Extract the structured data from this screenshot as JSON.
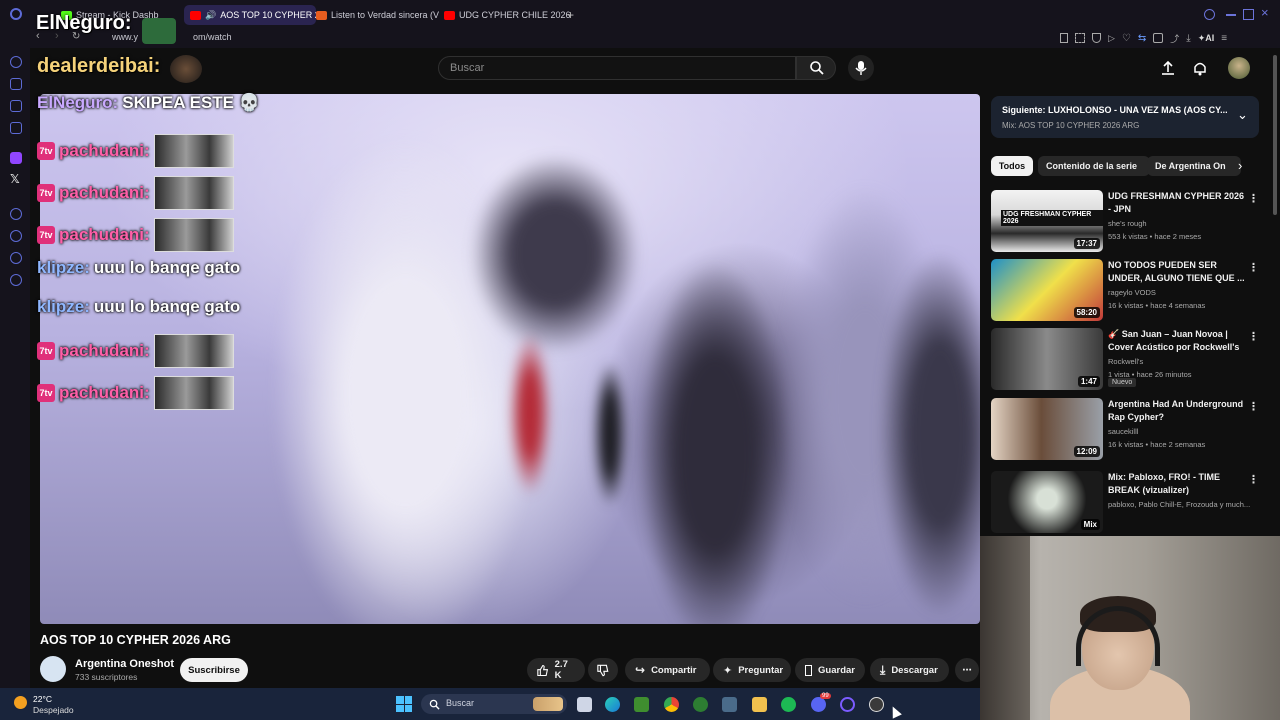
{
  "browser": {
    "tabs": [
      {
        "label": "Stream - Kick Dashb",
        "color": "#53fc18"
      },
      {
        "label": "AOS TOP 10 CYPHER 2",
        "color": "#ff0000"
      },
      {
        "label": "Listen to Verdad sincera (V",
        "color": "#e85d1f"
      },
      {
        "label": "UDG CYPHER CHILE 2026",
        "color": "#ff0000"
      }
    ],
    "url_fragment_start": "www.y",
    "url_fragment_end": "om/watch",
    "toolbar_ai_label": "AI"
  },
  "youtube": {
    "search_placeholder": "Buscar",
    "video_title": "AOS TOP 10 CYPHER 2026 ARG",
    "channel_name": "Argentina Oneshot",
    "channel_subs": "733 suscriptores",
    "subscribe_label": "Suscribirse",
    "likes": "2.7 K",
    "share_label": "Compartir",
    "ask_label": "Preguntar",
    "save_label": "Guardar",
    "download_label": "Descargar"
  },
  "up_next": {
    "title": "Siguiente: LUXHOLONSO - UNA VEZ MAS (AOS CY...",
    "subtitle": "Mix: AOS TOP 10 CYPHER 2026 ARG"
  },
  "chips": [
    "Todos",
    "Contenido de la serie",
    "De Argentina On"
  ],
  "recommendations": [
    {
      "title": "UDG FRESHMAN CYPHER 2026 - JPN",
      "channel": "she's rough",
      "meta": "553 k vistas • hace 2 meses",
      "duration": "17:37",
      "thumb_text": "UDG FRESHMAN CYPHER 2026"
    },
    {
      "title": "NO TODOS PUEDEN SER UNDER, ALGUNO TIENE QUE ...",
      "channel": "rageylo VODS",
      "meta": "16 k vistas • hace 4 semanas",
      "duration": "58:20"
    },
    {
      "title": "🎸 San Juan – Juan Novoa | Cover Acústico por Rockwell's",
      "channel": "Rockwell's",
      "meta": "1 vista • hace 26 minutos",
      "duration": "1:47",
      "badge": "Nuevo"
    },
    {
      "title": "Argentina Had An Underground Rap Cypher?",
      "channel": "saucekilll",
      "meta": "16 k vistas • hace 2 semanas",
      "duration": "12:09"
    },
    {
      "title": "Mix: Pabloxo, FRO! - TIME BREAK (vizualizer)",
      "channel": "pabloxo, Pablo Chill-E, Frozouda y much...",
      "meta": "",
      "duration": "Mix"
    }
  ],
  "stream_overlay": {
    "top_name": "ElNeguro:",
    "second_name": "dealerdeibai:",
    "chat": [
      {
        "user": "ElNeguro:",
        "text": "SKIPEA ESTE 💀",
        "color": "#c9a9ff",
        "badge": false,
        "emote": false
      },
      {
        "user": "pachudani:",
        "text": "",
        "color": "#ff5fa8",
        "badge": true,
        "emote": true
      },
      {
        "user": "pachudani:",
        "text": "",
        "color": "#ff5fa8",
        "badge": true,
        "emote": true
      },
      {
        "user": "pachudani:",
        "text": "",
        "color": "#ff5fa8",
        "badge": true,
        "emote": true
      },
      {
        "user": "klipze:",
        "text": "uuu lo banqe gato",
        "color": "#8fb7ff",
        "badge": false,
        "emote": false
      },
      {
        "user": "klipze:",
        "text": "uuu lo banqe gato",
        "color": "#8fb7ff",
        "badge": false,
        "emote": false
      },
      {
        "user": "pachudani:",
        "text": "",
        "color": "#ff5fa8",
        "badge": true,
        "emote": true
      },
      {
        "user": "pachudani:",
        "text": "",
        "color": "#ff5fa8",
        "badge": true,
        "emote": true
      }
    ],
    "badge_text": "7tv"
  },
  "taskbar": {
    "weather_temp": "22°C",
    "weather_desc": "Despejado",
    "search_placeholder": "Buscar",
    "discord_badge": "99"
  }
}
